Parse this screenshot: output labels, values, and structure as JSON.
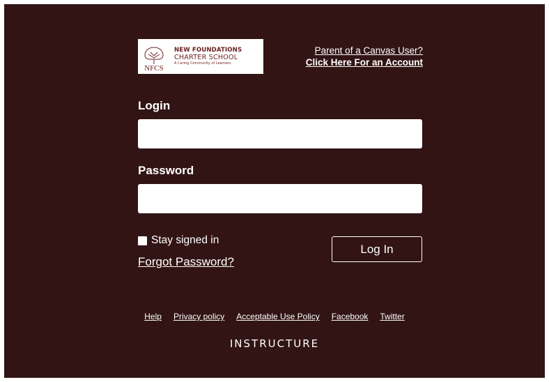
{
  "logo": {
    "initials": "NFCS",
    "line1": "NEW FOUNDATIONS",
    "line2": "CHARTER SCHOOL",
    "tagline": "A Caring Community of Learners"
  },
  "parent_link": {
    "line1": "Parent of a Canvas User?",
    "line2": "Click Here For an Account"
  },
  "form": {
    "login_label": "Login",
    "login_value": "",
    "password_label": "Password",
    "password_value": "",
    "stay_signed_in_label": "Stay signed in",
    "forgot_password_label": "Forgot Password?",
    "login_button_label": "Log In"
  },
  "footer": {
    "links": [
      "Help",
      "Privacy policy",
      "Acceptable Use Policy",
      "Facebook",
      "Twitter"
    ],
    "brand": "INSTRUCTURE"
  },
  "colors": {
    "background": "#321414",
    "text": "#ffffff",
    "logo_accent": "#6b1f1f"
  }
}
